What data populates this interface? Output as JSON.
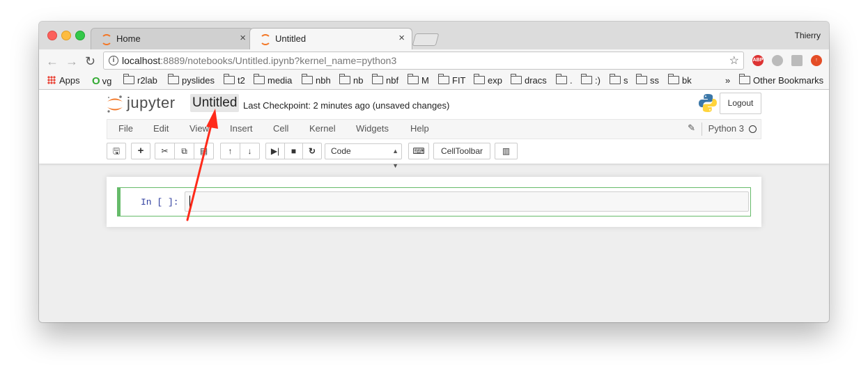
{
  "browser": {
    "tabs": [
      {
        "title": "Home",
        "close": "×"
      },
      {
        "title": "Untitled",
        "close": "×"
      }
    ],
    "user": "Thierry",
    "url": {
      "host": "localhost",
      "rest": ":8889/notebooks/Untitled.ipynb?kernel_name=python3"
    },
    "extensions": {
      "abp": "ABP"
    },
    "bookmarks": [
      "Apps",
      "vg",
      "r2lab",
      "pyslides",
      "t2",
      "media",
      "nbh",
      "nb",
      "nbf",
      "M",
      "FIT",
      "exp",
      "dracs",
      ".",
      ":)",
      "s",
      "ss",
      "bk"
    ],
    "bookmarks_more": "»",
    "other_bookmarks": "Other Bookmarks"
  },
  "jupyter": {
    "logo_text": "jupyter",
    "notebook_name": "Untitled",
    "checkpoint": "Last Checkpoint: 2 minutes ago (unsaved changes)",
    "logout_label": "Logout",
    "menu": [
      "File",
      "Edit",
      "View",
      "Insert",
      "Cell",
      "Kernel",
      "Widgets",
      "Help"
    ],
    "kernel_name": "Python 3",
    "cell_type": "Code",
    "celltoolbar_label": "CellToolbar",
    "cell_prompt": "In [ ]:"
  },
  "colors": {
    "jupyter_orange": "#f37726",
    "arrow_red": "#ff2a1a",
    "cell_green": "#66bb6a",
    "prompt_blue": "#303f9f"
  }
}
